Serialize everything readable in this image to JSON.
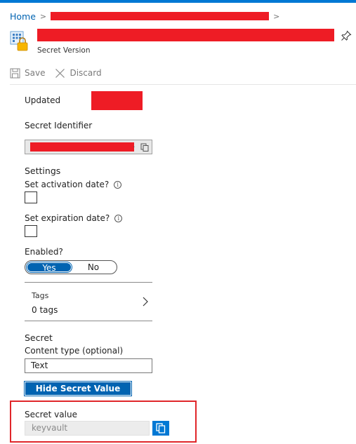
{
  "breadcrumb": {
    "home": "Home",
    "separator": ">"
  },
  "header": {
    "subtitle": "Secret Version",
    "icon": "key-vault-icon",
    "pin_icon": "pin-icon"
  },
  "toolbar": {
    "save_label": "Save",
    "discard_label": "Discard"
  },
  "form": {
    "updated_label": "Updated",
    "identifier_label": "Secret Identifier",
    "identifier_suffix": ".",
    "settings_heading": "Settings",
    "activation_label": "Set activation date?",
    "expiration_label": "Set expiration date?",
    "info_glyph": "i",
    "enabled_label": "Enabled?",
    "enabled_options": [
      "Yes",
      "No"
    ],
    "enabled_selected": "Yes",
    "tags_label": "Tags",
    "tags_value": "0 tags",
    "secret_heading": "Secret",
    "content_type_label": "Content type (optional)",
    "content_type_value": "Text",
    "hide_button_label": "Hide Secret Value",
    "secret_value_label": "Secret value",
    "secret_value": "keyvault"
  },
  "colors": {
    "accent": "#0063b1",
    "brand_bar": "#0078d4",
    "redaction": "#ee1c25",
    "highlight": "#e0262a"
  }
}
